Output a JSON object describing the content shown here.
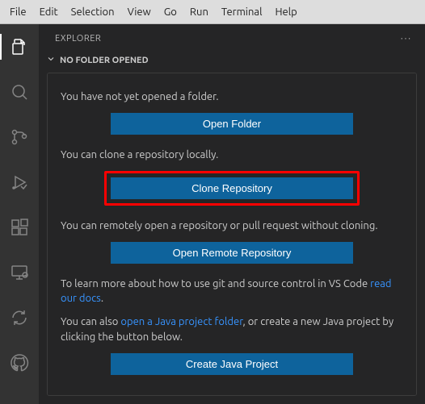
{
  "menubar": [
    "File",
    "Edit",
    "Selection",
    "View",
    "Go",
    "Run",
    "Terminal",
    "Help"
  ],
  "sidebar": {
    "title": "EXPLORER",
    "section": "NO FOLDER OPENED"
  },
  "welcome": {
    "no_folder_text": "You have not yet opened a folder.",
    "open_folder_btn": "Open Folder",
    "clone_text": "You can clone a repository locally.",
    "clone_btn": "Clone Repository",
    "remote_text": "You can remotely open a repository or pull request without cloning.",
    "remote_btn": "Open Remote Repository",
    "docs_text_prefix": "To learn more about how to use git and source control in VS Code ",
    "docs_link": "read our docs",
    "docs_text_suffix": ".",
    "java_text_prefix": "You can also ",
    "java_link": "open a Java project folder",
    "java_text_suffix": ", or create a new Java project by clicking the button below.",
    "java_btn": "Create Java Project"
  }
}
